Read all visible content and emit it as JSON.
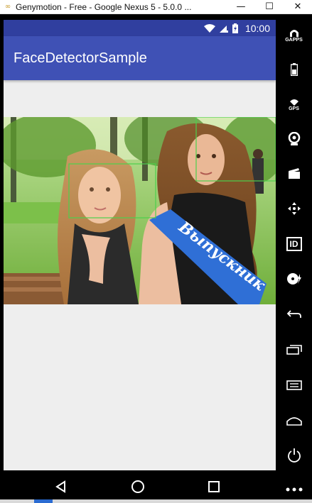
{
  "window": {
    "title": "Genymotion - Free - Google Nexus 5 - 5.0.0 ...",
    "app_icon": "∞",
    "minimize": "—",
    "maximize": "☐",
    "close": "✕"
  },
  "statusbar": {
    "time": "10:00",
    "icons": [
      "wifi-icon",
      "signal-icon",
      "battery-charging-icon"
    ]
  },
  "app": {
    "title": "FaceDetectorSample"
  },
  "toolbar": {
    "gapps_label": "GAPPS",
    "gps_label": "GPS",
    "id_label": "ID"
  },
  "nav": {
    "buttons": [
      "back-icon",
      "home-icon",
      "recents-icon"
    ]
  },
  "photo": {
    "sash_text": "Выпускник",
    "detected_faces": 2,
    "box_color": "#4cd04c"
  },
  "colors": {
    "status_bar": "#303f9f",
    "app_bar": "#3f51b5",
    "background": "#eeeeee"
  }
}
